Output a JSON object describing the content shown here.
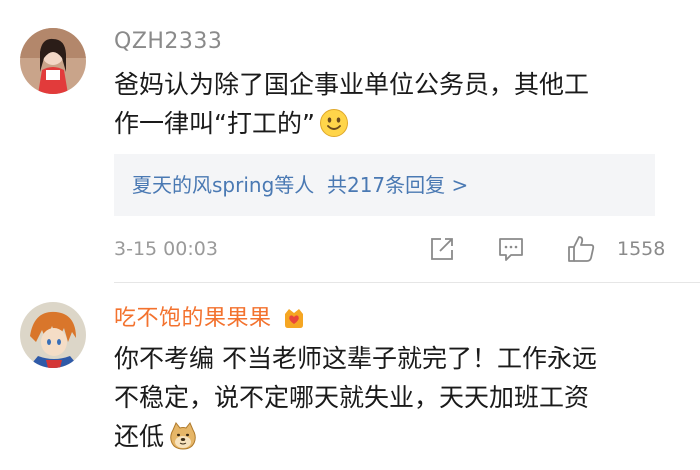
{
  "comments": [
    {
      "username": "QZH2333",
      "text_line1": "爸妈认为除了国企事业单位公务员，其他工",
      "text_line2": "作一律叫“打工的”",
      "emoji_icon": "smiley-emoji-icon",
      "replies_names": "夏天的风spring等人",
      "replies_count": "共217条回复 >",
      "timestamp": "3-15 00:03",
      "share_icon": "share-icon",
      "comment_icon": "comment-icon",
      "like_icon": "thumbs-up-icon",
      "like_count": "1558"
    },
    {
      "username": "吃不饱的果果果",
      "badge_icon": "crown-heart-badge-icon",
      "text_line1": "你不考编 不当老师这辈子就完了！工作永远",
      "text_line2": "不稳定，说不定哪天就失业，天天加班工资",
      "text_line3": "还低",
      "emoji_icon": "doge-emoji-icon"
    }
  ],
  "colors": {
    "username_gray": "#8a8a8a",
    "username_orange": "#f3722e",
    "reply_link_blue": "#4a79b3",
    "reply_box_bg": "#f4f5f7"
  }
}
